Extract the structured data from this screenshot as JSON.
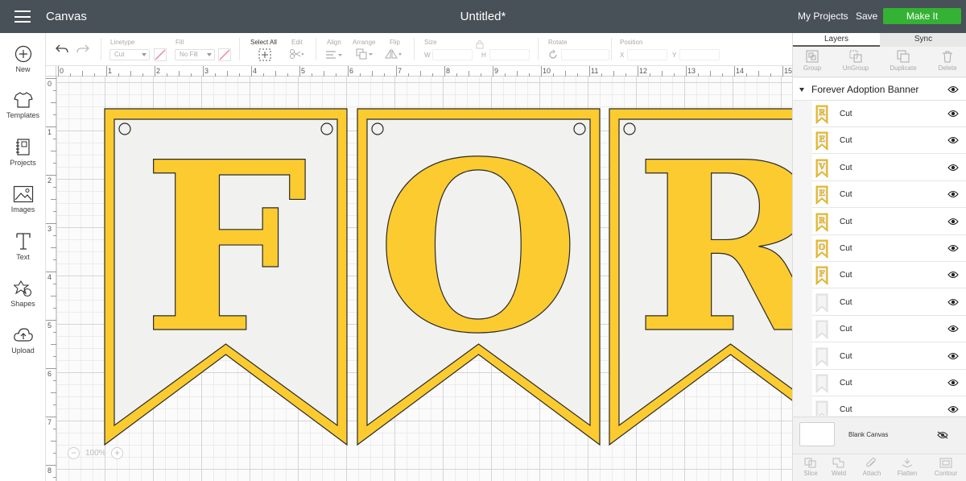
{
  "topbar": {
    "app_title": "Canvas",
    "doc_title": "Untitled*",
    "my_projects": "My Projects",
    "save": "Save",
    "make_it": "Make It",
    "make_it_color": "#34b233",
    "bar_color": "#485058"
  },
  "sidebar": {
    "items": [
      {
        "label": "New",
        "icon": "plus-circle-icon"
      },
      {
        "label": "Templates",
        "icon": "tshirt-icon"
      },
      {
        "label": "Projects",
        "icon": "notebook-icon"
      },
      {
        "label": "Images",
        "icon": "image-icon"
      },
      {
        "label": "Text",
        "icon": "text-icon"
      },
      {
        "label": "Shapes",
        "icon": "shapes-icon"
      },
      {
        "label": "Upload",
        "icon": "cloud-upload-icon"
      }
    ]
  },
  "toolbar": {
    "linetype_label": "Linetype",
    "linetype_value": "Cut",
    "fill_label": "Fill",
    "fill_value": "No Fill",
    "select_all": "Select All",
    "edit": "Edit",
    "align": "Align",
    "arrange": "Arrange",
    "flip": "Flip",
    "size": "Size",
    "w": "W",
    "h": "H",
    "rotate": "Rotate",
    "position": "Position",
    "x": "X",
    "y": "Y"
  },
  "ruler": {
    "top": [
      "0",
      "1",
      "2",
      "3",
      "4",
      "5",
      "6",
      "7",
      "8",
      "9",
      "10",
      "11",
      "12",
      "13",
      "14",
      "15"
    ],
    "left": [
      "0",
      "1",
      "2",
      "3",
      "4",
      "5",
      "6",
      "7",
      "8"
    ]
  },
  "canvas": {
    "zoom": "100%",
    "banner_letters": [
      "F",
      "O",
      "R"
    ],
    "banner_color": "#fbcb30",
    "panel_color": "#f1f2f0"
  },
  "panel": {
    "tabs": [
      "Layers",
      "Sync"
    ],
    "actions": [
      "Group",
      "UnGroup",
      "Duplicate",
      "Delete"
    ],
    "group_name": "Forever Adoption Banner",
    "layers": [
      {
        "letter": "R",
        "operation": "Cut"
      },
      {
        "letter": "E",
        "operation": "Cut"
      },
      {
        "letter": "V",
        "operation": "Cut"
      },
      {
        "letter": "E",
        "operation": "Cut"
      },
      {
        "letter": "R",
        "operation": "Cut"
      },
      {
        "letter": "O",
        "operation": "Cut"
      },
      {
        "letter": "F",
        "operation": "Cut"
      },
      {
        "letter": "",
        "operation": "Cut"
      },
      {
        "letter": "",
        "operation": "Cut"
      },
      {
        "letter": "",
        "operation": "Cut"
      },
      {
        "letter": "",
        "operation": "Cut"
      },
      {
        "letter": "",
        "operation": "Cut"
      }
    ],
    "blank_canvas": "Blank Canvas",
    "bottom_actions": [
      "Slice",
      "Weld",
      "Attach",
      "Flatten",
      "Contour"
    ]
  }
}
